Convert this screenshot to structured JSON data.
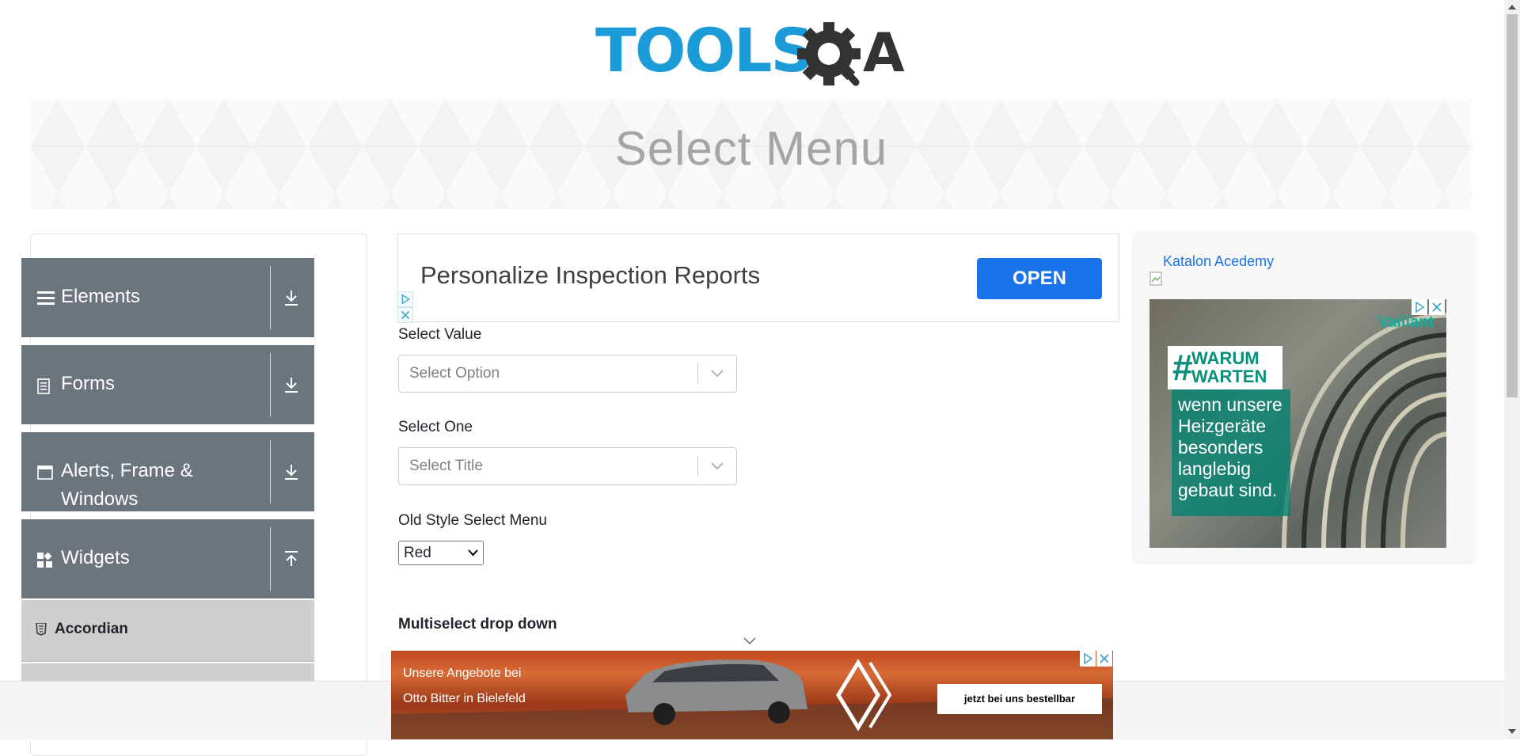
{
  "header": {
    "logo_text": "TOOLS",
    "logo_suffix": "A",
    "page_title": "Select Menu"
  },
  "sidebar": {
    "groups": [
      {
        "label": "Elements",
        "icon": "hamburger-icon",
        "arrow": "download-arrow-icon"
      },
      {
        "label": "Forms",
        "icon": "document-icon",
        "arrow": "download-arrow-icon"
      },
      {
        "label_line1": "Alerts, Frame &",
        "label_line2": "Windows",
        "icon": "window-icon",
        "arrow": "download-arrow-icon"
      },
      {
        "label": "Widgets",
        "icon": "widgets-icon",
        "arrow": "upload-arrow-icon"
      }
    ],
    "items": [
      {
        "label": "Accordian",
        "icon": "html5-icon"
      }
    ]
  },
  "ad_top": {
    "text": "Personalize Inspection Reports",
    "button": "OPEN"
  },
  "form": {
    "select_value": {
      "label": "Select Value",
      "placeholder": "Select Option"
    },
    "select_one": {
      "label": "Select One",
      "placeholder": "Select Title"
    },
    "old_style": {
      "label": "Old Style Select Menu",
      "selected": "Red"
    },
    "multiselect_heading": "Multiselect drop down"
  },
  "right_ad": {
    "link_text": "Katalon Acedemy",
    "brand": "Vaillant",
    "tag_line1": "WARUM",
    "tag_line2": "WARTEN",
    "tag_hash": "#",
    "body_lines": [
      "wenn unsere",
      "Heizgeräte",
      "besonders",
      "langlebig",
      "gebaut sind."
    ]
  },
  "bottom_ad": {
    "line1": "Unsere Angebote bei",
    "line2": "Otto Bitter in Bielefeld",
    "button": "jetzt bei uns bestellbar"
  },
  "colors": {
    "accent": "#1b9bd8",
    "sidebar_group": "#6c757d",
    "sidebar_item": "#cfcfcf",
    "ad_button": "#1a73e8",
    "title_gray": "#a5a5a5"
  }
}
